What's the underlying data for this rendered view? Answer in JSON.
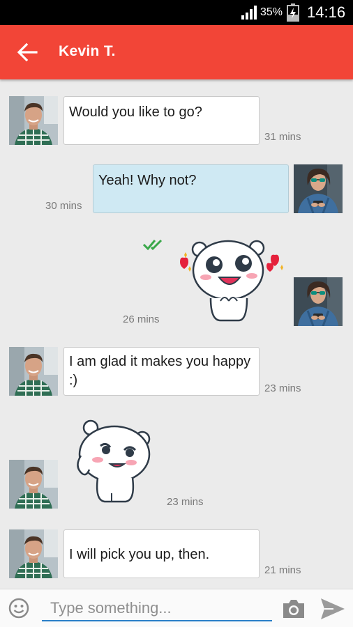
{
  "status_bar": {
    "battery_percent": "35%",
    "time": "14:16"
  },
  "header": {
    "contact_name": "Kevin T.",
    "back_icon": "arrow-left-icon"
  },
  "messages": [
    {
      "side": "in",
      "type": "text",
      "text": "Would you like to go?",
      "time": "31 mins"
    },
    {
      "side": "out",
      "type": "text",
      "text": "Yeah! Why not?",
      "time": "30 mins"
    },
    {
      "side": "out",
      "type": "sticker",
      "sticker": "bear-sticker-hearts",
      "time": "26 mins",
      "read_receipt": "double-check-icon"
    },
    {
      "side": "in",
      "type": "text",
      "text": "I am glad it makes you happy :)",
      "time": "23 mins"
    },
    {
      "side": "in",
      "type": "sticker",
      "sticker": "bear-sticker-blushing",
      "time": "23 mins"
    },
    {
      "side": "in",
      "type": "text",
      "text": "I will pick you up, then.",
      "time": "21 mins"
    }
  ],
  "composer": {
    "placeholder": "Type something...",
    "emoji_icon": "smiley-icon",
    "camera_icon": "camera-icon",
    "send_icon": "send-icon"
  },
  "colors": {
    "accent": "#f24537",
    "outgoing_bubble": "#cfe9f3",
    "input_underline": "#2a7fc8",
    "read_receipt": "#3aa84a"
  }
}
